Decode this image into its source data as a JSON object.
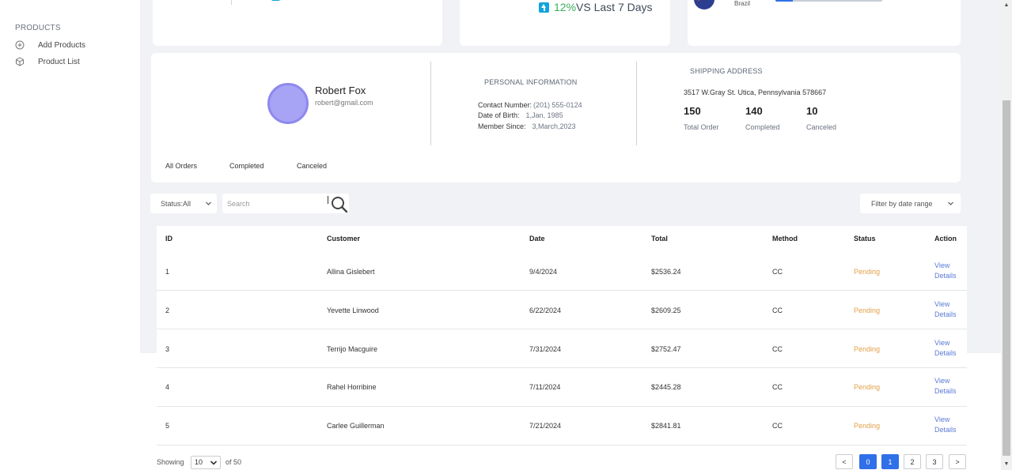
{
  "sidebar": {
    "heading": "PRODUCTS",
    "items": [
      {
        "label": "Add Products",
        "icon": "plus-circle-icon"
      },
      {
        "label": "Product List",
        "icon": "cube-icon"
      }
    ]
  },
  "stats": {
    "trend_percent": "12%",
    "trend_text": "VS Last 7 Days",
    "country": "Brazil",
    "colors": {
      "trend_up": "#3cab5a",
      "arrow": "#11a4dc"
    }
  },
  "profile": {
    "name": "Robert Fox",
    "email": "robert@gmail.com",
    "personal": {
      "title": "PERSONAL INFORMATION",
      "contact_label": "Contact Number:",
      "contact_value": "(201) 555-0124",
      "dob_label": "Date of Birth:",
      "dob_value": "1,Jan, 1985",
      "member_label": "Member Since:",
      "member_value": "3,March,2023"
    },
    "shipping": {
      "title": "SHIPPING ADDRESS",
      "address": "3517 W.Gray St. Utica, Pennsylvania 578667",
      "total_orders": "150",
      "total_orders_label": "Total Order",
      "completed": "140",
      "completed_label": "Completed",
      "canceled": "10",
      "canceled_label": "Canceled"
    }
  },
  "order_tabs": [
    "All Orders",
    "Completed",
    "Canceled"
  ],
  "filters": {
    "status": "Status:All",
    "search_placeholder": "Search",
    "date_range": "Filter by date range"
  },
  "table": {
    "headers": [
      "ID",
      "Customer",
      "Date",
      "Total",
      "Method",
      "Status",
      "Action"
    ],
    "rows": [
      {
        "id": "1",
        "customer": "Allina Gislebert",
        "date": "9/4/2024",
        "total": "$2536.24",
        "method": "CC",
        "status": "Pending",
        "action": "View Details"
      },
      {
        "id": "2",
        "customer": "Yevette Linwood",
        "date": "6/22/2024",
        "total": "$2609.25",
        "method": "CC",
        "status": "Pending",
        "action": "View Details"
      },
      {
        "id": "3",
        "customer": "Terrijo Macguire",
        "date": "7/31/2024",
        "total": "$2752.47",
        "method": "CC",
        "status": "Pending",
        "action": "View Details"
      },
      {
        "id": "4",
        "customer": "Rahel Horribine",
        "date": "7/11/2024",
        "total": "$2445.28",
        "method": "CC",
        "status": "Pending",
        "action": "View Details"
      },
      {
        "id": "5",
        "customer": "Carlee Guillerman",
        "date": "7/21/2024",
        "total": "$2841.81",
        "method": "CC",
        "status": "Pending",
        "action": "View Details"
      }
    ],
    "colors": {
      "pending": "#e3a04a",
      "link": "#5b7bd6"
    }
  },
  "pagination": {
    "showing_label": "Showing",
    "per_page": "10",
    "of_label": "of 50",
    "prev": "<",
    "pages": [
      "0",
      "1",
      "2",
      "3"
    ],
    "next": ">",
    "active_color": "#2f6fe8"
  }
}
